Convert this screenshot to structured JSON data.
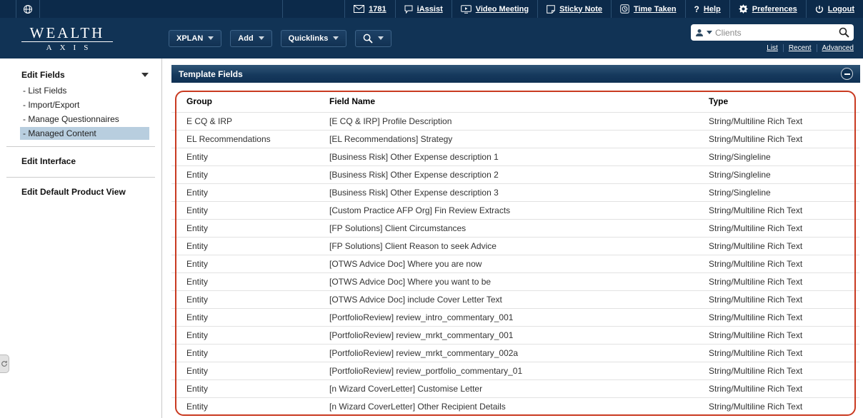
{
  "utility_bar": {
    "mail_count": "1781",
    "iassist_label": "iAssist",
    "video_meeting_label": "Video Meeting",
    "sticky_note_label": "Sticky Note",
    "time_taken_label": "Time Taken",
    "help_icon": "?",
    "help_label": "Help",
    "preferences_label": "Preferences",
    "logout_label": "Logout"
  },
  "header": {
    "logo_line1": "WEALTH",
    "logo_line2": "AXIS",
    "xplan_button": "XPLAN",
    "add_button": "Add",
    "quicklinks_button": "Quicklinks",
    "client_search_placeholder": "Clients",
    "search_links": {
      "list": "List",
      "recent": "Recent",
      "advanced": "Advanced"
    }
  },
  "sidebar": {
    "edit_fields": {
      "title": "Edit Fields",
      "items": [
        {
          "label": "List Fields",
          "selected": false
        },
        {
          "label": "Import/Export",
          "selected": false
        },
        {
          "label": "Manage Questionnaires",
          "selected": false
        },
        {
          "label": "Managed Content",
          "selected": true
        }
      ]
    },
    "edit_interface_title": "Edit Interface",
    "edit_default_title": "Edit Default Product View"
  },
  "panel": {
    "title": "Template Fields",
    "columns": [
      "Group",
      "Field Name",
      "Type"
    ],
    "rows": [
      [
        "E CQ & IRP",
        "[E CQ & IRP] Profile Description",
        "String/Multiline Rich Text"
      ],
      [
        "EL Recommendations",
        "[EL Recommendations] Strategy",
        "String/Multiline Rich Text"
      ],
      [
        "Entity",
        "[Business Risk] Other Expense description 1",
        "String/Singleline"
      ],
      [
        "Entity",
        "[Business Risk] Other Expense description 2",
        "String/Singleline"
      ],
      [
        "Entity",
        "[Business Risk] Other Expense description 3",
        "String/Singleline"
      ],
      [
        "Entity",
        "[Custom Practice AFP Org] Fin Review Extracts",
        "String/Multiline Rich Text"
      ],
      [
        "Entity",
        "[FP Solutions] Client Circumstances",
        "String/Multiline Rich Text"
      ],
      [
        "Entity",
        "[FP Solutions] Client Reason to seek Advice",
        "String/Multiline Rich Text"
      ],
      [
        "Entity",
        "[OTWS Advice Doc] Where you are now",
        "String/Multiline Rich Text"
      ],
      [
        "Entity",
        "[OTWS Advice Doc] Where you want to be",
        "String/Multiline Rich Text"
      ],
      [
        "Entity",
        "[OTWS Advice Doc] include Cover Letter Text",
        "String/Multiline Rich Text"
      ],
      [
        "Entity",
        "[PortfolioReview] review_intro_commentary_001",
        "String/Multiline Rich Text"
      ],
      [
        "Entity",
        "[PortfolioReview] review_mrkt_commentary_001",
        "String/Multiline Rich Text"
      ],
      [
        "Entity",
        "[PortfolioReview] review_mrkt_commentary_002a",
        "String/Multiline Rich Text"
      ],
      [
        "Entity",
        "[PortfolioReview] review_portfolio_commentary_01",
        "String/Multiline Rich Text"
      ],
      [
        "Entity",
        "[n Wizard CoverLetter] Customise Letter",
        "String/Multiline Rich Text"
      ],
      [
        "Entity",
        "[n Wizard CoverLetter] Other Recipient Details",
        "String/Multiline Rich Text"
      ]
    ]
  },
  "colors": {
    "navy": "#113355",
    "annotation_red": "#c93a21",
    "selected_item_bg": "#b8cedf"
  }
}
